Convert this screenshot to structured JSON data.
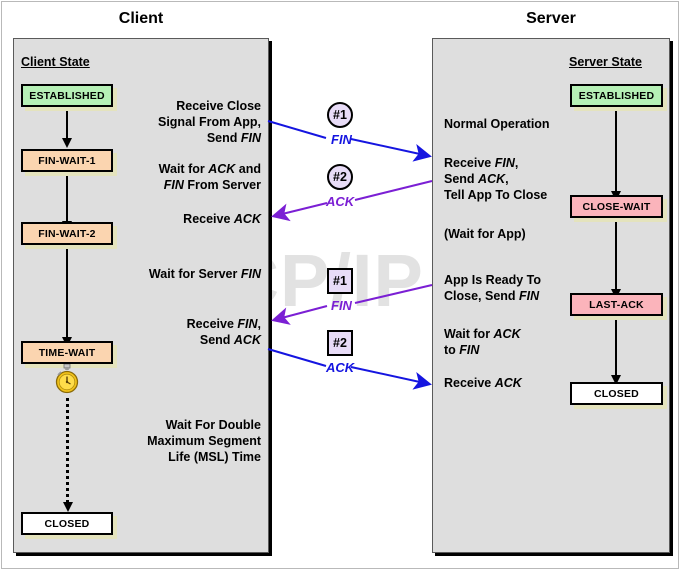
{
  "titles": {
    "client": "Client",
    "server": "Server"
  },
  "client": {
    "state_heading": "Client State",
    "states": [
      {
        "label": "ESTABLISHED",
        "color": "#b6f0b6"
      },
      {
        "label": "FIN-WAIT-1",
        "color": "#fbd5b0"
      },
      {
        "label": "FIN-WAIT-2",
        "color": "#fbd5b0"
      },
      {
        "label": "TIME-WAIT",
        "color": "#fbd5b0"
      },
      {
        "label": "CLOSED",
        "color": "#ffffff"
      }
    ],
    "notes": [
      {
        "text": "Receive Close\nSignal From App,\nSend FIN"
      },
      {
        "text": "Wait for ACK and\nFIN From Server"
      },
      {
        "text": "Receive ACK"
      },
      {
        "text": "Wait for Server FIN"
      },
      {
        "text": "Receive FIN,\nSend ACK"
      },
      {
        "text": "Wait For Double\nMaximum Segment\nLife (MSL) Time"
      }
    ]
  },
  "server": {
    "state_heading": "Server State",
    "states": [
      {
        "label": "ESTABLISHED",
        "color": "#b6f0b6"
      },
      {
        "label": "CLOSE-WAIT",
        "color": "#fbb4bb"
      },
      {
        "label": "LAST-ACK",
        "color": "#fbb4bb"
      },
      {
        "label": "CLOSED",
        "color": "#ffffff"
      }
    ],
    "notes": [
      {
        "text": "Normal Operation"
      },
      {
        "text": "Receive FIN,\nSend ACK,\nTell App To Close"
      },
      {
        "text": "(Wait for App)"
      },
      {
        "text": "App Is Ready To\nClose, Send FIN"
      },
      {
        "text": "Wait for ACK\nto FIN"
      },
      {
        "text": "Receive ACK"
      }
    ]
  },
  "messages": [
    {
      "badge": "#1",
      "shape": "circle",
      "label": "FIN",
      "direction": "client-to-server",
      "color": "#1515e0"
    },
    {
      "badge": "#2",
      "shape": "circle",
      "label": "ACK",
      "direction": "server-to-client",
      "color": "#7b1fd4"
    },
    {
      "badge": "#1",
      "shape": "square",
      "label": "FIN",
      "direction": "server-to-client",
      "color": "#7b1fd4"
    },
    {
      "badge": "#2",
      "shape": "square",
      "label": "ACK",
      "direction": "client-to-server",
      "color": "#1515e0"
    }
  ],
  "watermark": "The TCP/IP Guide",
  "icons": {
    "timer": "stopwatch-icon"
  },
  "colors": {
    "panel_bg": "#dedede",
    "established": "#b6f0b6",
    "fin_wait": "#fbd5b0",
    "close_wait": "#fbb4bb",
    "closed": "#ffffff",
    "shadow": "#e4e3bd",
    "blue": "#1515e0",
    "purple": "#7b1fd4",
    "badge_bg": "#e8dcf7"
  }
}
